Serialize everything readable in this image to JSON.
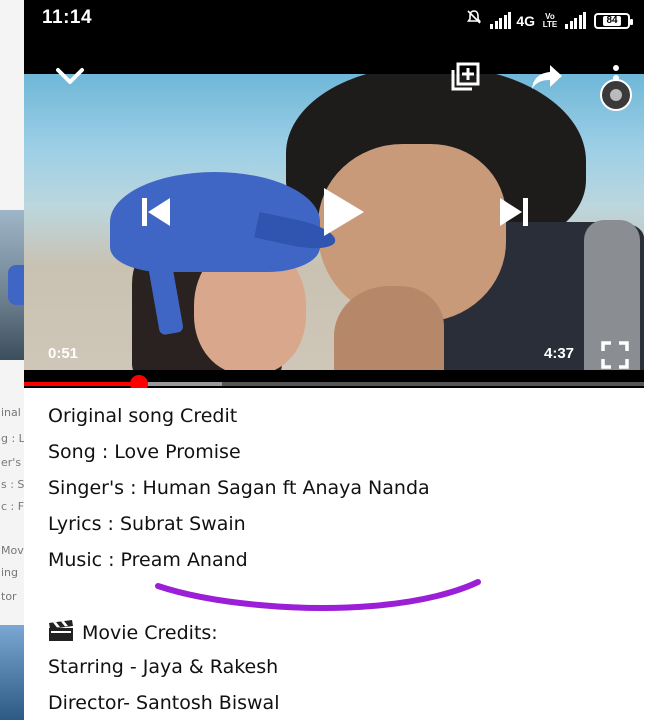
{
  "status_bar": {
    "time": "11:14",
    "network": "4G",
    "volte": "Vo LTE",
    "battery_level": "84"
  },
  "player": {
    "current_time": "0:51",
    "total_time": "4:37",
    "progress": 0.185,
    "buffered": 0.32,
    "icons": [
      "chevron-down-icon",
      "add-to-queue-icon",
      "share-icon",
      "channel-avatar",
      "previous-icon",
      "play-icon",
      "next-icon",
      "fullscreen-icon"
    ],
    "accent": "#ff0000"
  },
  "description": {
    "line1": "Original song Credit",
    "line2": "Song : Love Promise",
    "line3": "Singer's : Human Sagan ft Anaya Nanda",
    "line4": "Lyrics : Subrat Swain",
    "line5": "Music : Pream Anand",
    "movie_credits": "Movie Credits:",
    "starring": "Starring - Jaya & Rakesh",
    "director": "Director- Santosh Biswal",
    "annotation_color": "#9b1fd6"
  },
  "background_fragments": [
    "inal",
    "g : L",
    "er's",
    "s : S",
    "c : F",
    "Movi",
    "ing",
    "tor"
  ]
}
